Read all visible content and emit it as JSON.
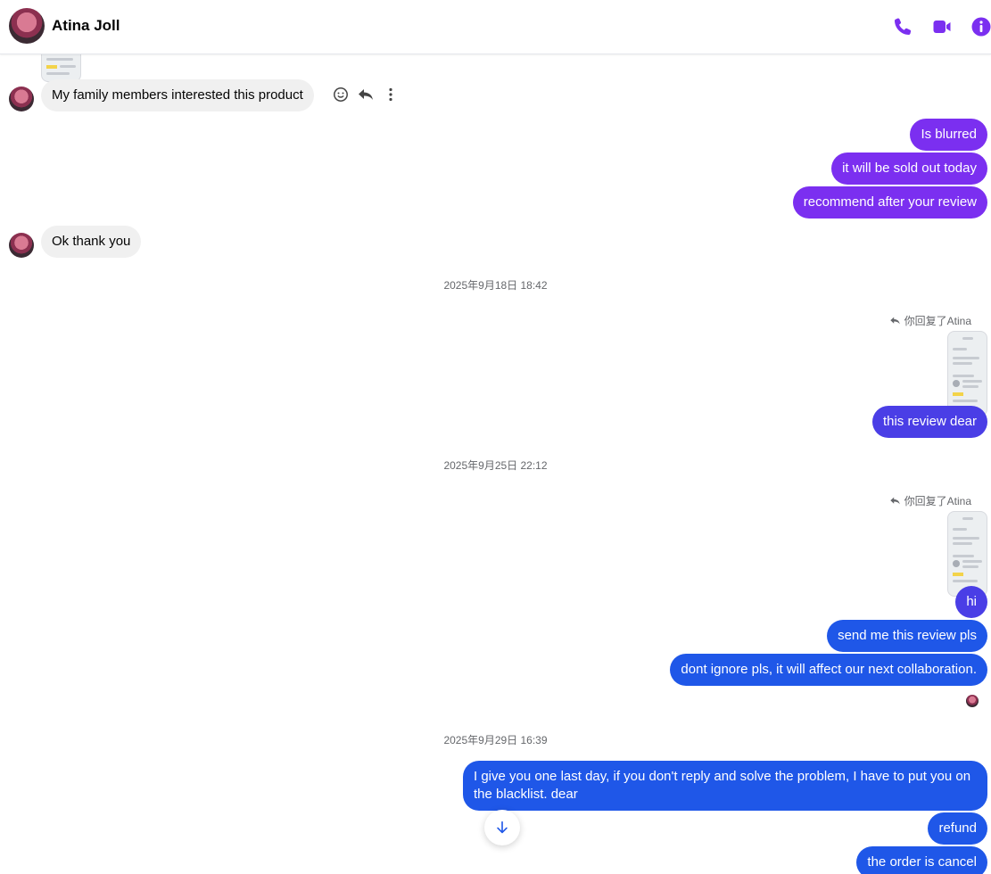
{
  "header": {
    "contact_name": "Atina Joll",
    "icons": [
      "phone-icon",
      "video-camera-icon",
      "info-icon"
    ],
    "accent_color": "#7b2ff0"
  },
  "messages": {
    "in_1": "My family members interested this product",
    "out_1": "Is blurred",
    "out_2": "it will be sold out today",
    "out_3": "recommend after your review",
    "in_2": "Ok thank you",
    "ts_1": "2025年9月18日 18:42",
    "reply_note_1": "你回复了Atina",
    "out_4": "this review dear",
    "ts_2": "2025年9月25日 22:12",
    "reply_note_2": "你回复了Atina",
    "out_5": "hi",
    "out_6": "send me this review pls",
    "out_7": "dont ignore pls, it will affect our next collaboration.",
    "ts_3": "2025年9月29日 16:39",
    "out_8": "I give you one last day, if you don't reply and solve the problem, I have to put you on the blacklist. dear",
    "out_9": "refund",
    "out_10": "the order is cancel"
  },
  "colors": {
    "outgoing_purple": "#7b2ff0",
    "outgoing_indigo": "#4a3ee6",
    "outgoing_blue": "#1f57e8",
    "incoming_gray": "#f0f0f0"
  }
}
